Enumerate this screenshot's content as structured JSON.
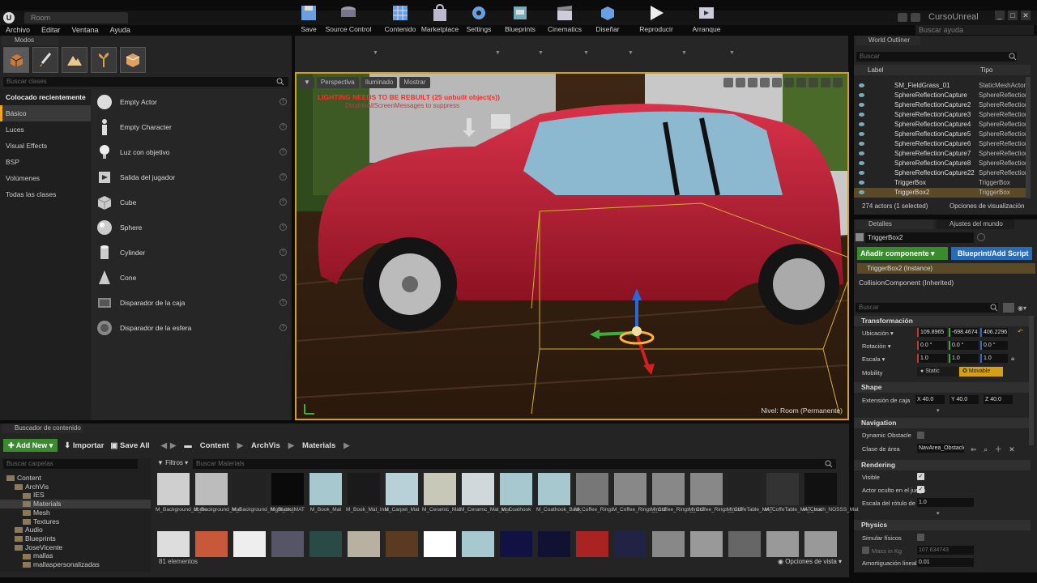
{
  "window": {
    "project_title": "CursoUnreal",
    "doc_tab": "Room",
    "help_search": "Buscar ayuda"
  },
  "menu": [
    "Archivo",
    "Editar",
    "Ventana",
    "Ayuda"
  ],
  "modes": {
    "tab": "Modos",
    "search_placeholder": "Buscar clases",
    "categories": [
      "Colocado recientemente",
      "Básico",
      "Luces",
      "Visual Effects",
      "BSP",
      "Volúmenes",
      "Todas las clases"
    ],
    "selected_category": "Básico",
    "items": [
      "Empty Actor",
      "Empty Character",
      "Luz con objetivo",
      "Salida del jugador",
      "Cube",
      "Sphere",
      "Cylinder",
      "Cone",
      "Disparador de la caja",
      "Disparador de la esfera"
    ]
  },
  "toolbar": [
    "Save",
    "Source Control",
    "Contenido",
    "Marketplace",
    "Settings",
    "Blueprints",
    "Cinematics",
    "Diseñar",
    "Reproducir",
    "Arranque"
  ],
  "viewport": {
    "perspective": "Perspectiva",
    "lit": "Iluminado",
    "show": "Mostrar",
    "warning": "LIGHTING NEEDS TO BE REBUILT (25 unbuilt object(s))",
    "warning2": "DisableAllScreenMessages to suppress",
    "level_label": "Nivel:",
    "level_value": "Room (Permanente)"
  },
  "outliner": {
    "tab": "World Outliner",
    "search_placeholder": "Buscar",
    "col_label": "Label",
    "col_type": "Tipo",
    "rows": [
      {
        "name": "SM_FieldGrass_01",
        "type": "StaticMeshActor"
      },
      {
        "name": "SphereReflectionCapture",
        "type": "SphereReflectionCapture"
      },
      {
        "name": "SphereReflectionCapture2",
        "type": "SphereReflectionCapture"
      },
      {
        "name": "SphereReflectionCapture3",
        "type": "SphereReflectionCapture"
      },
      {
        "name": "SphereReflectionCapture4",
        "type": "SphereReflectionCapture"
      },
      {
        "name": "SphereReflectionCapture5",
        "type": "SphereReflectionCapture"
      },
      {
        "name": "SphereReflectionCapture6",
        "type": "SphereReflectionCapture"
      },
      {
        "name": "SphereReflectionCapture7",
        "type": "SphereReflectionCapture"
      },
      {
        "name": "SphereReflectionCapture8",
        "type": "SphereReflectionCapture"
      },
      {
        "name": "SphereReflectionCapture22",
        "type": "SphereReflectionCapture"
      },
      {
        "name": "TriggerBox",
        "type": "TriggerBox"
      },
      {
        "name": "TriggerBox2",
        "type": "TriggerBox",
        "selected": true
      }
    ],
    "footer_count": "274 actors (1 selected)",
    "view_options": "Opciones de visualización"
  },
  "details": {
    "tab": "Detalles",
    "tab2": "Ajustes del mundo",
    "name": "TriggerBox2",
    "add_component": "Añadir componente",
    "blueprint_add": "Blueprint/Add Script",
    "instance": "TriggerBox2 (Instance)",
    "collision": "CollisionComponent (Inherited)",
    "search_placeholder": "Buscar",
    "transform": {
      "header": "Transformación",
      "location_label": "Ubicación",
      "location": [
        "109.8965",
        "-698.4674",
        "406.2296"
      ],
      "rotation_label": "Rotación",
      "rotation": [
        "0.0 °",
        "0.0 °",
        "0.0 °"
      ],
      "scale_label": "Escala",
      "scale": [
        "1.0",
        "1.0",
        "1.0"
      ],
      "mobility_label": "Mobility",
      "static": "Static",
      "movable": "Movable"
    },
    "shape": {
      "header": "Shape",
      "extent_label": "Extensión de caja",
      "extent": [
        "X 40.0",
        "Y 40.0",
        "Z 40.0"
      ]
    },
    "navigation": {
      "header": "Navigation",
      "dynamic_label": "Dynamic Obstacle",
      "area_label": "Clase de área",
      "area_value": "NavArea_Obstacle"
    },
    "rendering": {
      "header": "Rendering",
      "visible_label": "Visible",
      "hidden_label": "Actor oculto en el juego",
      "billboard_label": "Escala del rótulo de ...",
      "billboard_value": "1.0"
    },
    "physics": {
      "header": "Physics",
      "simulate_label": "Simular físicos",
      "mass_label": "Mass in Kg",
      "mass_value": "107.634743",
      "damping_label": "Amortiguación lineal",
      "damping_value": "0.01"
    }
  },
  "content_browser": {
    "tab": "Buscador de contenido",
    "add_new": "Add New",
    "import": "Importar",
    "save_all": "Save All",
    "path": [
      "Content",
      "ArchVis",
      "Materials"
    ],
    "folder_search": "Buscar carpetas",
    "filters": "Filtros",
    "asset_search": "Buscar Materials",
    "folders": [
      {
        "name": "Content",
        "depth": 0
      },
      {
        "name": "ArchVis",
        "depth": 1
      },
      {
        "name": "IES",
        "depth": 2
      },
      {
        "name": "Materials",
        "depth": 2,
        "selected": true
      },
      {
        "name": "Mesh",
        "depth": 2
      },
      {
        "name": "Textures",
        "depth": 2
      },
      {
        "name": "Audio",
        "depth": 1
      },
      {
        "name": "Blueprints",
        "depth": 1
      },
      {
        "name": "JoseVicente",
        "depth": 1
      },
      {
        "name": "mallas",
        "depth": 2
      },
      {
        "name": "mallaspersonalizadas",
        "depth": 2
      }
    ],
    "assets": [
      "M_Background_dome",
      "M_Background_Mat",
      "M_Background_Night_Inst",
      "M_Black_MAT",
      "M_Book_Mat",
      "M_Book_Mat_Inst",
      "M_Carpet_Mat",
      "M_Ceramic_Mat",
      "M_Ceramic_Mat_Inst",
      "M_Coathook",
      "M_Coathook_Back",
      "M_Coffee_Rings",
      "M_Coffee_Rings_Inst1",
      "M_Coffee_Rings_Inst2",
      "M_Coffee_Rings_Inst3",
      "M_CoffeTable_MAT",
      "M_CoffeTable_MAT_Inst",
      "M_Couch_NOSSS_Mat"
    ],
    "count": "81 elementos",
    "view_options": "Opciones de vista"
  }
}
